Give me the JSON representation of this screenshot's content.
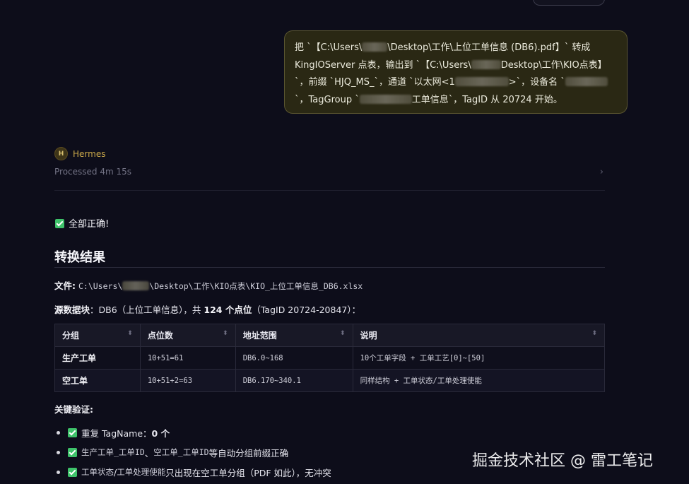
{
  "user_message": {
    "line1_a": "把 `【C:\\Users\\",
    "line1_b": "\\Desktop\\工作\\上位工单信息 (DB6).pdf】` 转成",
    "line2_a": "KingIOServer 点表，输出到 `【C:\\Users\\",
    "line2_b": "Desktop\\工作\\KIO点表】",
    "line3_a": "`，前缀 `HJQ_MS_`，通道 `以太网<1",
    "line3_b": ">`，设备名 `",
    "line4_a": "`，TagGroup `",
    "line4_b": "工单信息`，TagID 从 20724 开始。"
  },
  "agent": {
    "avatar_letter": "H",
    "name": "Hermes",
    "processed": "Processed 4m 15s",
    "chevron": "›"
  },
  "result": {
    "all_correct": "全部正确!",
    "section_title": "转换结果",
    "file_label": "文件:",
    "file_path_a": "C:\\Users\\",
    "file_path_b": "\\Desktop\\工作\\KIO点表\\KIO_上位工单信息_DB6.xlsx",
    "src_label": "源数据块",
    "src_text_a": "：DB6（上位工单信息），共 ",
    "src_count": "124 个点位",
    "src_text_b": "（TagID 20724-20847）："
  },
  "table": {
    "headers": [
      "分组",
      "点位数",
      "地址范围",
      "说明"
    ],
    "sort_icon": "⬍",
    "rows": [
      [
        "生产工单",
        "10+51=61",
        "DB6.0~168",
        "10个工单字段 + 工单工艺[0]~[50]"
      ],
      [
        "空工单",
        "10+51+2=63",
        "DB6.170~340.1",
        "同样结构 + 工单状态/工单处理使能"
      ]
    ]
  },
  "verify": {
    "title": "关键验证:",
    "item1_a": "重复 TagName：",
    "item1_b": "0 个",
    "item2_a": "生产工单_工单ID",
    "item2_b": " 、 ",
    "item2_c": "空工单_工单ID",
    "item2_d": " 等自动分组前缀正确",
    "item3_a": "工单状态",
    "item3_b": " / ",
    "item3_c": "工单处理使能",
    "item3_d": " 只出现在空工单分组（PDF 如此），无冲突"
  },
  "watermark": "掘金技术社区 @ 雷工笔记"
}
